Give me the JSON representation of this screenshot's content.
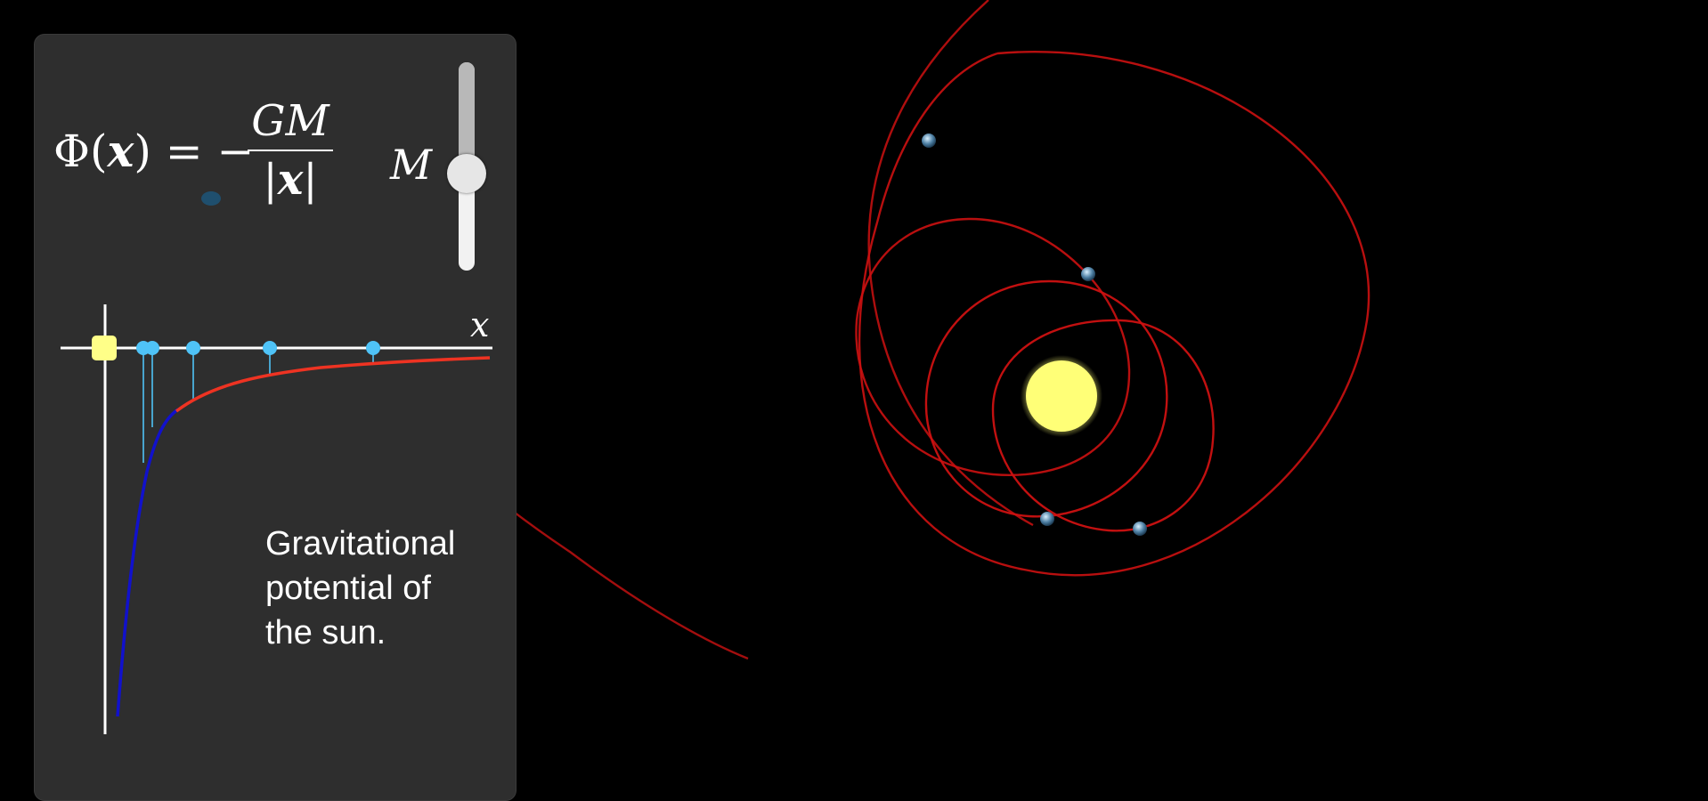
{
  "formula": {
    "lhs": "Φ(x) = −",
    "lhs_symbol": "Φ",
    "lhs_var": "x",
    "numerator": "GM",
    "denominator_var": "x"
  },
  "slider": {
    "label": "M",
    "value": 0.5
  },
  "graph": {
    "axis_x_label": "x"
  },
  "caption": {
    "lines": [
      "Gravitational",
      "potential of",
      "the sun."
    ]
  },
  "colors": {
    "panel": "#2e2e2e",
    "sun": "#ffff77",
    "orbit": "#cc1111",
    "potential_near": "#1111cc",
    "potential_far": "#ee3322",
    "planet_marker": "#4fc3f7",
    "sun_marker": "#ffff88"
  }
}
